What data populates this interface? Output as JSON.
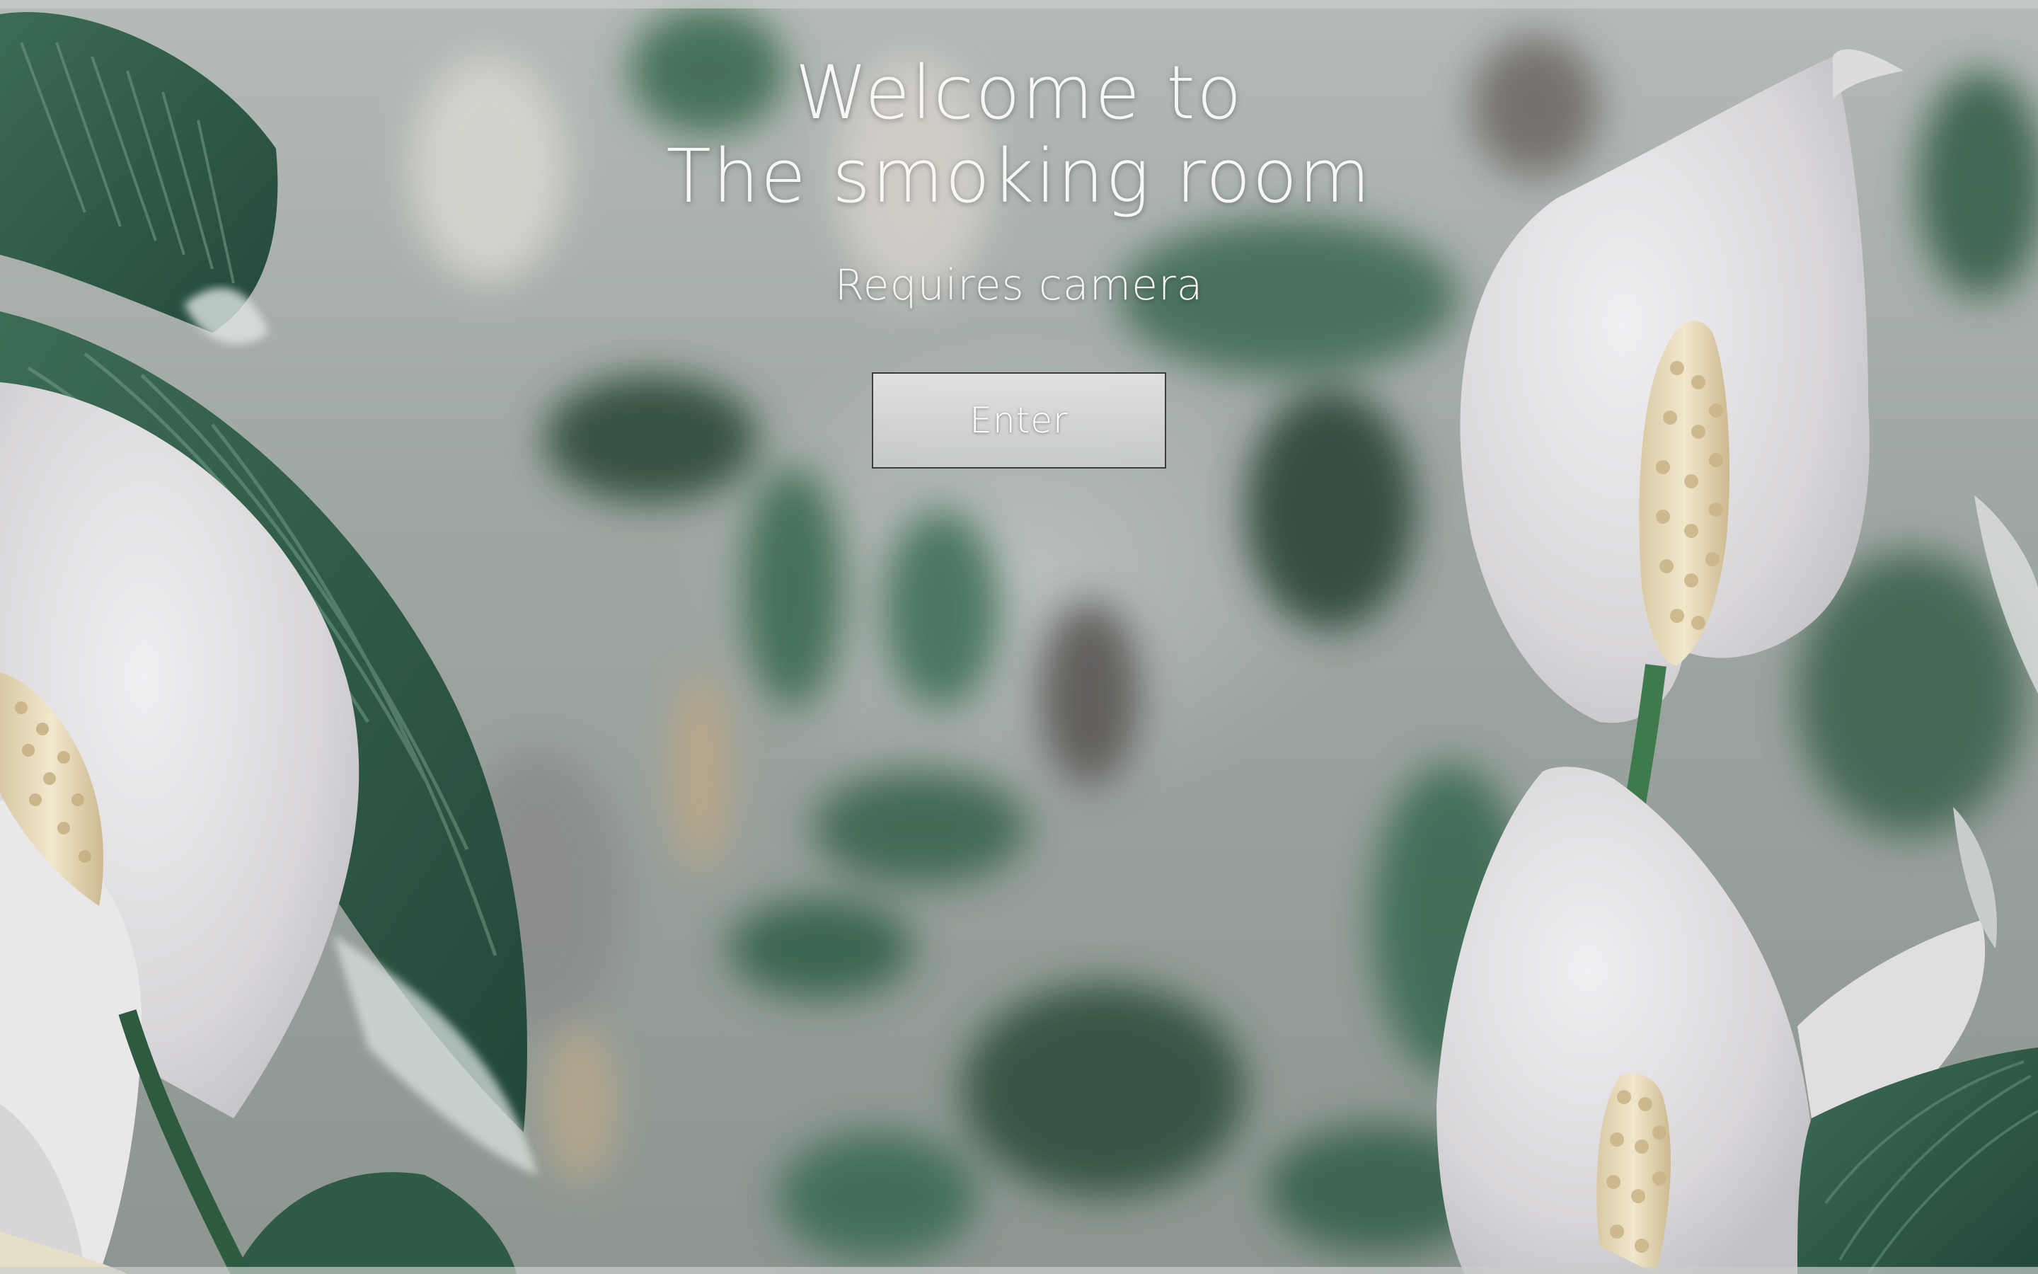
{
  "welcome": {
    "title_line1": "Welcome to",
    "title_line2": "The smoking room",
    "subtitle": "Requires camera"
  },
  "actions": {
    "enter_label": "Enter"
  },
  "colors": {
    "text": "#f7f7f5",
    "leaf_green": "#2f5a45",
    "petal_white": "#e6e4e6",
    "spadix_cream": "#e8dcc0",
    "backdrop_gray": "#9fa7a3"
  }
}
